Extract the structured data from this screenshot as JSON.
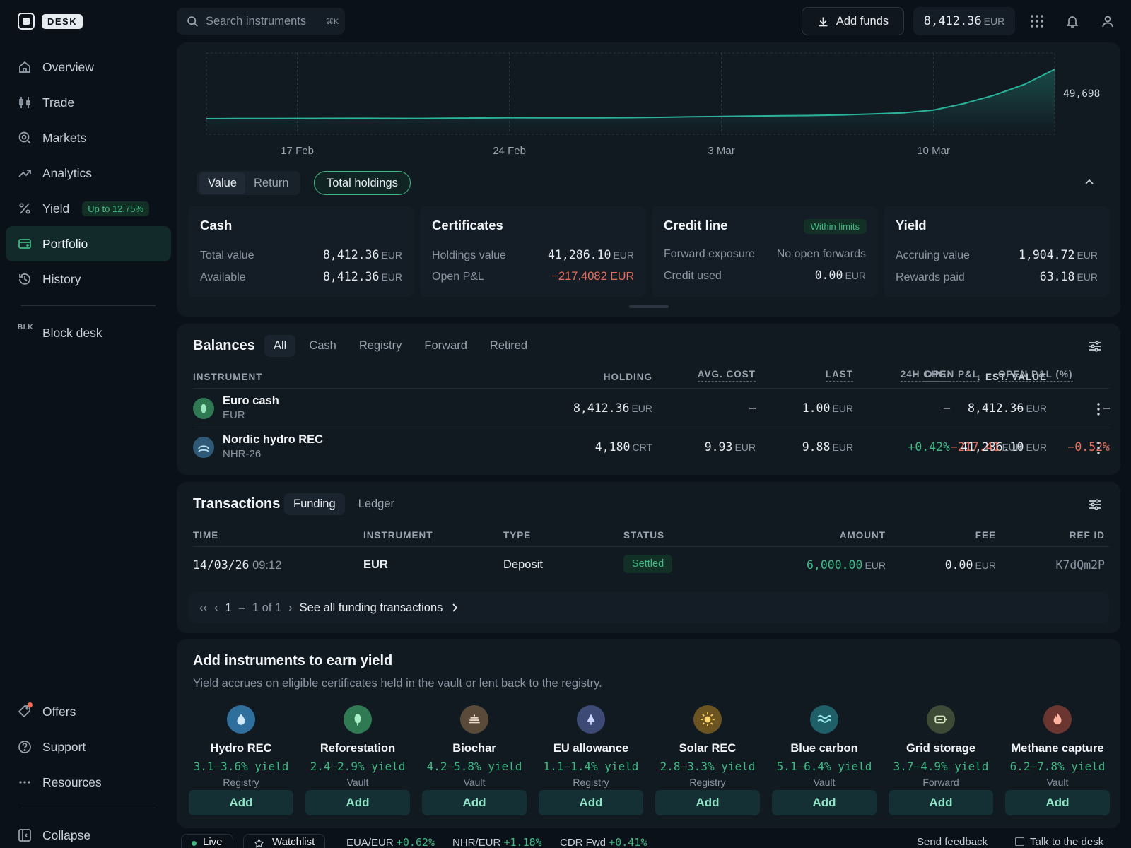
{
  "app": {
    "brand": "DESK"
  },
  "search": {
    "placeholder": "Search instruments",
    "shortcut": "⌘K"
  },
  "header": {
    "add_funds_label": "Add funds",
    "balance_value": "8,412.36",
    "balance_unit": "EUR"
  },
  "sidebar": {
    "items": [
      {
        "label": "Overview",
        "icon": "home-icon"
      },
      {
        "label": "Trade",
        "icon": "candlestick-icon"
      },
      {
        "label": "Markets",
        "icon": "markets-icon"
      },
      {
        "label": "Analytics",
        "icon": "trend-icon"
      },
      {
        "label": "Yield",
        "icon": "percent-icon",
        "badge": "Up to 12.75%"
      },
      {
        "label": "Portfolio",
        "icon": "wallet-icon",
        "active": true
      },
      {
        "label": "History",
        "icon": "history-icon"
      }
    ],
    "block_desk": {
      "prefix": "BLK",
      "label": "Block desk"
    },
    "bottom": [
      {
        "label": "Offers",
        "icon": "tag-icon"
      },
      {
        "label": "Support",
        "icon": "help-icon"
      },
      {
        "label": "Resources",
        "icon": "dots-icon"
      }
    ],
    "collapse_label": "Collapse"
  },
  "chart_data": {
    "type": "area",
    "x": [
      "14 Feb",
      "15 Feb",
      "16 Feb",
      "17 Feb",
      "18 Feb",
      "19 Feb",
      "20 Feb",
      "21 Feb",
      "22 Feb",
      "23 Feb",
      "24 Feb",
      "25 Feb",
      "26 Feb",
      "27 Feb",
      "28 Feb",
      "1 Mar",
      "2 Mar",
      "3 Mar",
      "4 Mar",
      "5 Mar",
      "6 Mar",
      "7 Mar",
      "8 Mar",
      "9 Mar",
      "10 Mar",
      "11 Mar",
      "12 Mar",
      "13 Mar",
      "14 Mar"
    ],
    "values": [
      8300,
      8400,
      8500,
      8550,
      8600,
      8650,
      8600,
      8550,
      8700,
      8900,
      9100,
      9050,
      9000,
      9000,
      9200,
      9500,
      9900,
      10200,
      10500,
      10800,
      11000,
      11500,
      12300,
      13200,
      15500,
      21000,
      28000,
      37000,
      49698
    ],
    "tick_labels": [
      "17 Feb",
      "24 Feb",
      "3 Mar",
      "10 Mar"
    ],
    "last_value_label": "49,698",
    "color": "#2bb39a",
    "grid": true
  },
  "chart_controls": {
    "tabs": [
      "Value",
      "Return"
    ],
    "active_tab": "Value",
    "holdings_pill": "Total holdings"
  },
  "summary": {
    "cash": {
      "title": "Cash",
      "rows": [
        {
          "label": "Total value",
          "value": "8,412.36",
          "unit": "EUR"
        },
        {
          "label": "Available",
          "value": "8,412.36",
          "unit": "EUR"
        }
      ]
    },
    "certificates": {
      "title": "Certificates",
      "rows": [
        {
          "label": "Holdings value",
          "value": "41,286.10",
          "unit": "EUR"
        },
        {
          "label": "Open P&L",
          "value": "−217.4082",
          "unit": "EUR"
        }
      ]
    },
    "credit": {
      "title": "Credit line",
      "badge": "Within limits",
      "rows": [
        {
          "label": "Forward exposure",
          "value": "No open forwards",
          "unit": ""
        },
        {
          "label": "Credit used",
          "value": "0.00",
          "unit": "EUR"
        }
      ]
    },
    "yield": {
      "title": "Yield",
      "rows": [
        {
          "label": "Accruing value",
          "value": "1,904.72",
          "unit": "EUR"
        },
        {
          "label": "Rewards paid",
          "value": "63.18",
          "unit": "EUR"
        }
      ]
    }
  },
  "balances": {
    "title": "Balances",
    "tabs": [
      "All",
      "Cash",
      "Registry",
      "Forward",
      "Retired"
    ],
    "active_tab": "All",
    "columns": [
      "INSTRUMENT",
      "HOLDING",
      "AVG. COST",
      "LAST",
      "24H CHG.",
      "↓ EST. VALUE",
      "OPEN P&L",
      "OPEN P&L (%)"
    ],
    "rows": [
      {
        "name": "Euro cash",
        "code": "EUR",
        "holding": "8,412.36",
        "holding_unit": "EUR",
        "avg_cost": "–",
        "avg_cost_unit": "",
        "last": "1.00",
        "last_unit": "EUR",
        "chg": "–",
        "est_value": "8,412.36",
        "est_unit": "EUR",
        "pnl": "–",
        "pnl_unit": "",
        "pnl_pct": "–"
      },
      {
        "name": "Nordic hydro REC",
        "code": "NHR-26",
        "holding": "4,180",
        "holding_unit": "CRT",
        "avg_cost": "9.93",
        "avg_cost_unit": "EUR",
        "last": "9.88",
        "last_unit": "EUR",
        "chg": "+0.42%",
        "est_value": "41,286.10",
        "est_unit": "EUR",
        "pnl": "−217.41",
        "pnl_unit": "EUR",
        "pnl_pct": "−0.52%"
      }
    ]
  },
  "transactions": {
    "title": "Transactions",
    "tabs": [
      "Funding",
      "Ledger"
    ],
    "active_tab": "Funding",
    "columns": [
      "TIME",
      "INSTRUMENT",
      "TYPE",
      "STATUS",
      "AMOUNT",
      "FEE",
      "REF ID"
    ],
    "rows": [
      {
        "date": "14/03/26",
        "time": "09:12",
        "instrument": "EUR",
        "type": "Deposit",
        "status": "Settled",
        "amount": "6,000.00",
        "amount_unit": "EUR",
        "fee": "0.00",
        "fee_unit": "EUR",
        "ref": "K7dQm2P"
      }
    ],
    "pager": {
      "first": "‹‹",
      "prev": "‹",
      "page": "1",
      "dash": "–",
      "of": "1 of 1",
      "next": "›",
      "see_all": "See all funding transactions"
    }
  },
  "yield_section": {
    "title": "Add instruments to earn yield",
    "subtitle": "Yield accrues on eligible certificates held in the vault or lent back to the registry.",
    "cards": [
      {
        "name": "Hydro REC",
        "rate": "3.1–3.6% yield",
        "type": "Registry",
        "icon": "water-drop-icon",
        "color": "#2e6f9e",
        "button": "Add"
      },
      {
        "name": "Reforestation",
        "rate": "2.4–2.9% yield",
        "type": "Vault",
        "icon": "leaf-icon",
        "color": "#2f7a52",
        "button": "Add"
      },
      {
        "name": "Biochar",
        "rate": "4.2–5.8% yield",
        "type": "Vault",
        "icon": "layers-icon",
        "color": "#5a4a3a",
        "button": "Add"
      },
      {
        "name": "EU allowance",
        "rate": "1.1–1.4% yield",
        "type": "Registry",
        "icon": "triangle-icon",
        "color": "#3d4a75",
        "button": "Add"
      },
      {
        "name": "Solar REC",
        "rate": "2.8–3.3% yield",
        "type": "Registry",
        "icon": "sun-icon",
        "color": "#6b5420",
        "button": "Add"
      },
      {
        "name": "Blue carbon",
        "rate": "5.1–6.4% yield",
        "type": "Vault",
        "icon": "waves-icon",
        "color": "#1e5f68",
        "button": "Add"
      },
      {
        "name": "Grid storage",
        "rate": "3.7–4.9% yield",
        "type": "Forward",
        "icon": "battery-icon",
        "color": "#3d4a36",
        "button": "Add"
      },
      {
        "name": "Methane capture",
        "rate": "6.2–7.8% yield",
        "type": "Vault",
        "icon": "flame-icon",
        "color": "#6b3530",
        "button": "Add"
      }
    ]
  },
  "footer": {
    "live": "Live",
    "watchlist": "Watchlist",
    "tickers": [
      {
        "pair": "EUA/EUR",
        "chg": "+0.62%"
      },
      {
        "pair": "NHR/EUR",
        "chg": "+1.18%"
      },
      {
        "pair": "CDR Fwd",
        "chg": "+0.41%"
      }
    ],
    "feedback": "Send feedback",
    "talk": "Talk to the desk"
  }
}
